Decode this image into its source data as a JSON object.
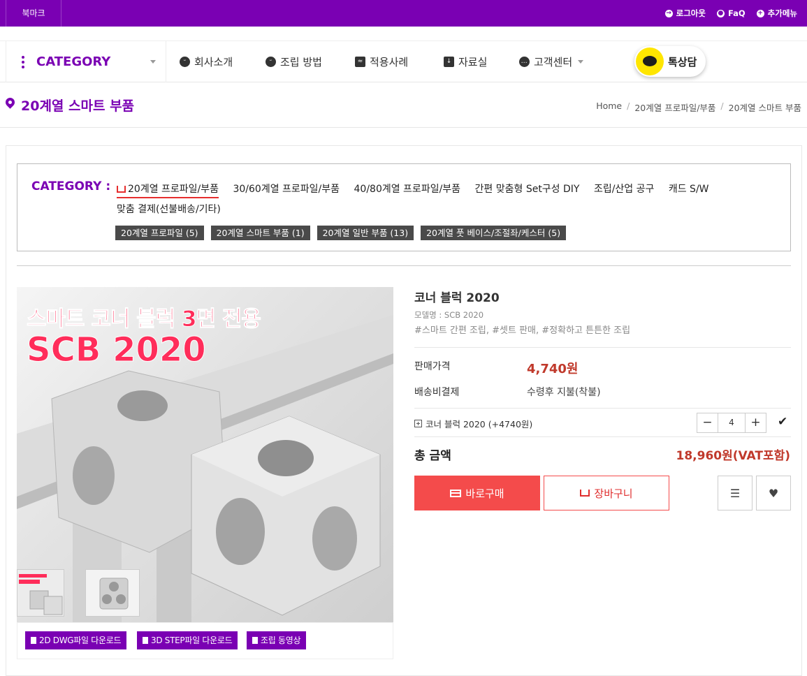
{
  "topbar": {
    "bookmark": "북마크",
    "logout": "로그아웃",
    "faq": "FaQ",
    "more_menu": "추가메뉴"
  },
  "nav": {
    "category": "CATEGORY",
    "items": [
      "회사소개",
      "조립 방법",
      "적용사례",
      "자료실",
      "고객센터"
    ],
    "kakao": "톡상담"
  },
  "page": {
    "title": "20계열 스마트 부품",
    "breadcrumb": [
      "Home",
      "20계열 프로파일/부품",
      "20계열 스마트 부품"
    ]
  },
  "categorybox": {
    "label": "CATEGORY :",
    "links": [
      "20계열 프로파일/부품",
      "30/60계열 프로파일/부품",
      "40/80계열 프로파일/부품",
      "간편 맞춤형 Set구성 DIY",
      "조립/산업 공구",
      "캐드 S/W",
      "맞춤 결제(선불배송/기타)"
    ],
    "subtags": [
      "20계열 프로파일 (5)",
      "20계열 스마트 부품 (1)",
      "20계열 일반 부품 (13)",
      "20계열 풋 베이스/조절좌/케스터 (5)"
    ]
  },
  "image": {
    "headline": "스마트 코너 블럭 3면 전용",
    "code": "SCB 2020"
  },
  "downloads": [
    "2D DWG파일 다운로드",
    "3D STEP파일 다운로드",
    "조립 동영상"
  ],
  "product": {
    "name": "코너 블럭 2020",
    "model": "모델명 : SCB 2020",
    "tags": "#스마트 간편 조립, #셋트 판매, #정확하고 튼튼한 조립",
    "price_label": "판매가격",
    "price": "4,740원",
    "shipping_label": "배송비결제",
    "shipping": "수령후 지불(착불)",
    "option": "코너 블럭 2020 (+4740원)",
    "quantity": "4",
    "total_label": "총 금액",
    "total": "18,960원(VAT포함)",
    "buy_label": "바로구매",
    "cart_label": "장바구니"
  },
  "colors": {
    "brand": "#7a00b3",
    "accent": "#f44b4b",
    "price": "#c0392b"
  }
}
